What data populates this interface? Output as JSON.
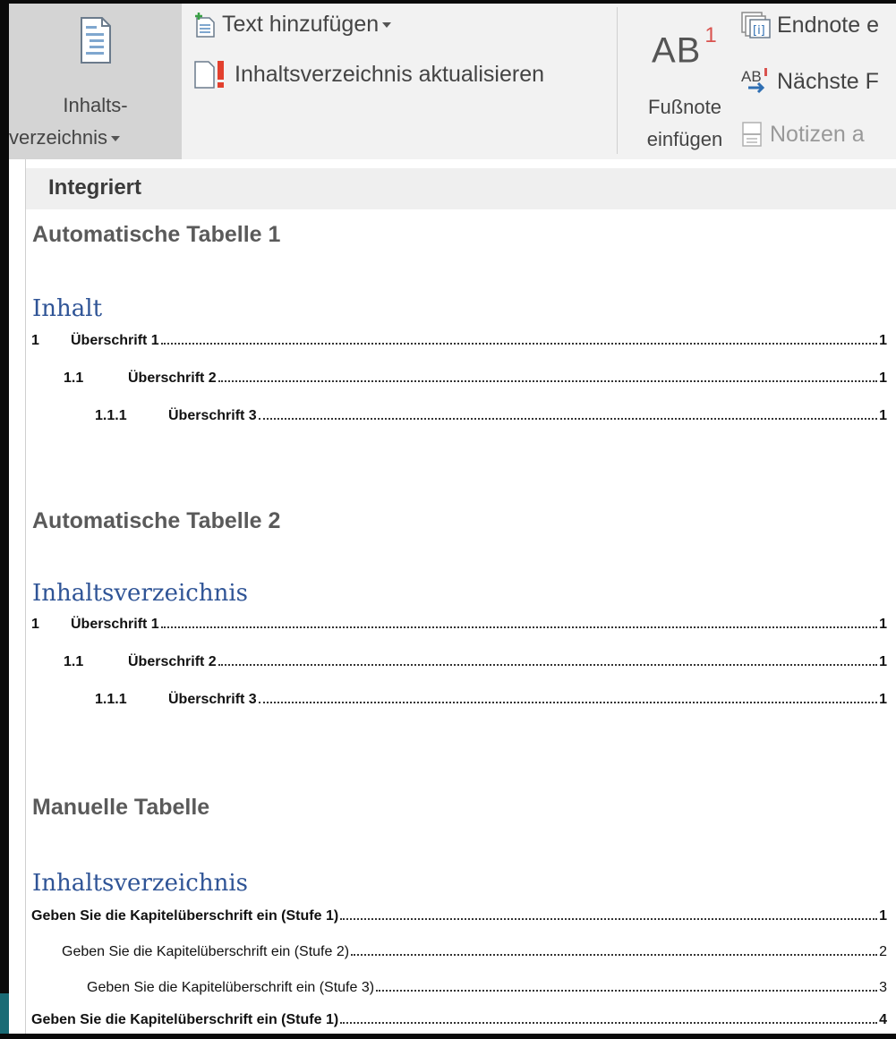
{
  "ribbon": {
    "toc_button": {
      "line1": "Inhalts-",
      "line2": "verzeichnis"
    },
    "add_text": "Text hinzufügen",
    "update_toc": "Inhaltsverzeichnis aktualisieren",
    "insert_footnote": {
      "line1": "Fußnote",
      "line2": "einfügen",
      "icon_text": "AB",
      "icon_sup": "1"
    },
    "insert_endnote": "Endnote e",
    "next_footnote": "Nächste F",
    "next_footnote_icon": "AB",
    "show_notes": "Notizen a"
  },
  "gallery": {
    "category": "Integriert",
    "auto1": {
      "title": "Automatische Tabelle 1",
      "heading": "Inhalt",
      "entries": [
        {
          "num": "1",
          "label": "Überschrift 1",
          "page": "1"
        },
        {
          "num": "1.1",
          "label": "Überschrift 2",
          "page": "1"
        },
        {
          "num": "1.1.1",
          "label": "Überschrift 3",
          "page": "1"
        }
      ]
    },
    "auto2": {
      "title": "Automatische Tabelle 2",
      "heading": "Inhaltsverzeichnis",
      "entries": [
        {
          "num": "1",
          "label": "Überschrift 1",
          "page": "1"
        },
        {
          "num": "1.1",
          "label": "Überschrift 2",
          "page": "1"
        },
        {
          "num": "1.1.1",
          "label": "Überschrift 3",
          "page": "1"
        }
      ]
    },
    "manual": {
      "title": "Manuelle Tabelle",
      "heading": "Inhaltsverzeichnis",
      "entries": [
        {
          "label": "Geben Sie die Kapitelüberschrift ein (Stufe 1)",
          "page": "1"
        },
        {
          "label": "Geben Sie die Kapitelüberschrift ein (Stufe 2)",
          "page": "2"
        },
        {
          "label": "Geben Sie die Kapitelüberschrift ein (Stufe 3)",
          "page": "3"
        },
        {
          "label": "Geben Sie die Kapitelüberschrift ein (Stufe 1)",
          "page": "4"
        }
      ]
    }
  },
  "colors": {
    "heading_blue": "#2f5496",
    "footnote_red": "#d9534f",
    "taskbar_teal": "#1a6b75"
  }
}
